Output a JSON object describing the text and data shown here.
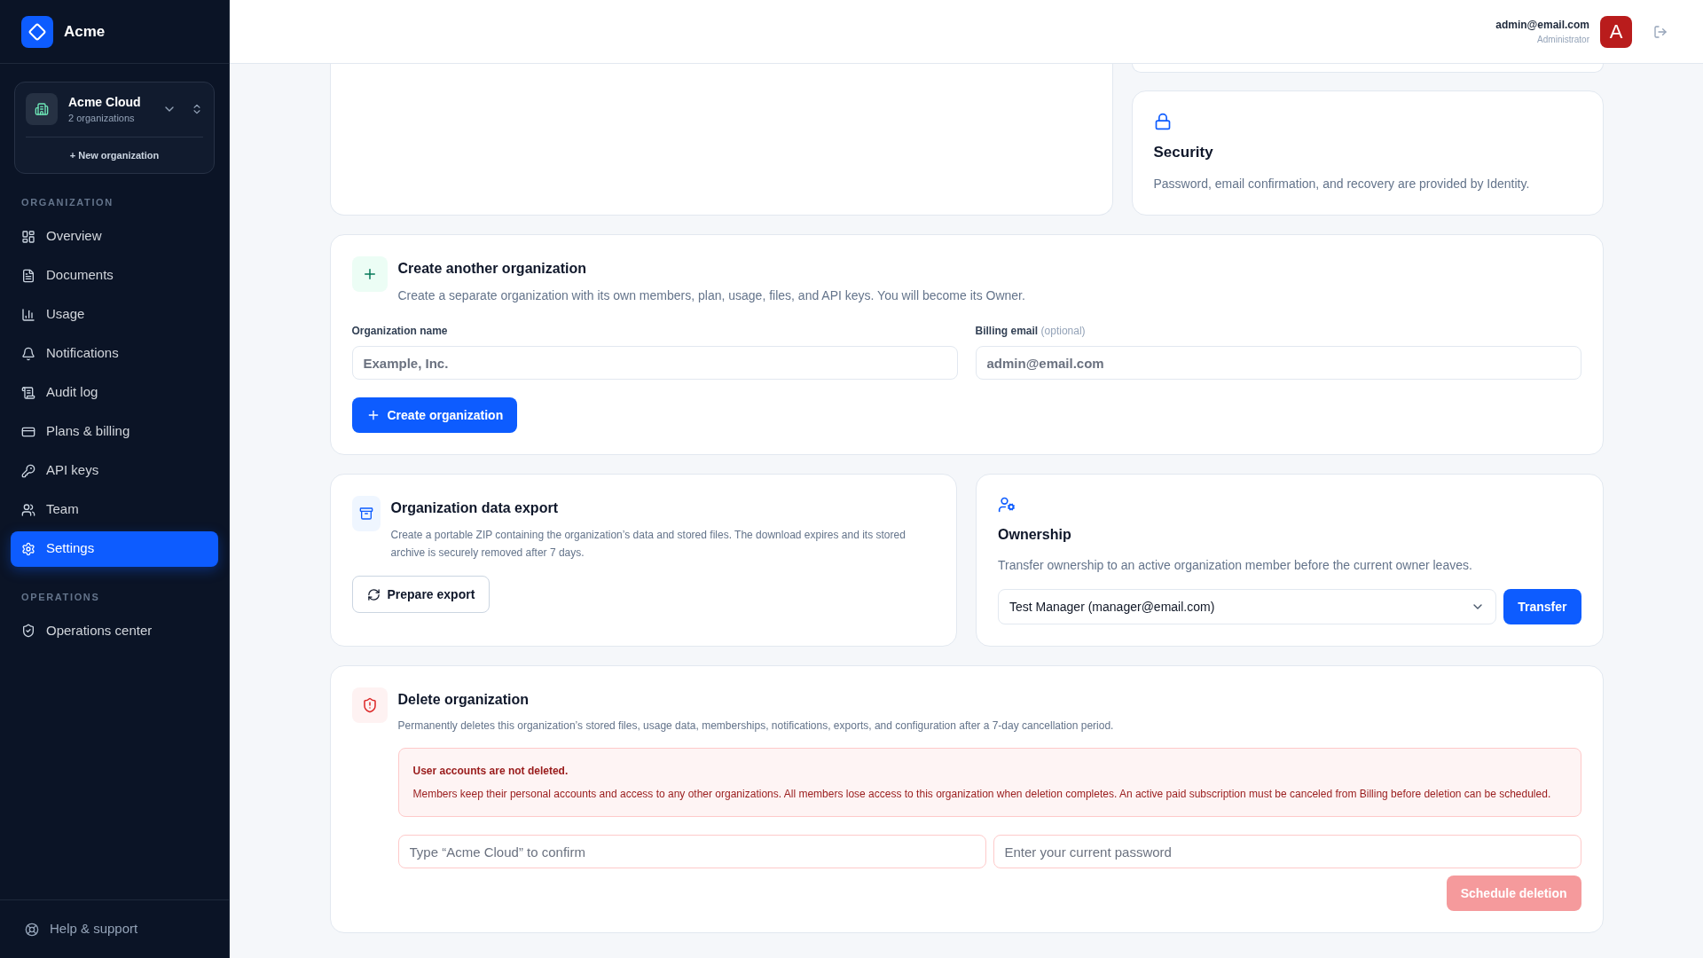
{
  "sidebar": {
    "brand": "Acme",
    "org_switcher": {
      "name": "Acme Cloud",
      "subtitle": "2 organizations",
      "new_button": "+ New organization"
    },
    "sections": [
      {
        "heading": "ORGANIZATION",
        "items": [
          {
            "label": "Overview",
            "selected": false
          },
          {
            "label": "Documents",
            "selected": false
          },
          {
            "label": "Usage",
            "selected": false
          },
          {
            "label": "Notifications",
            "selected": false
          },
          {
            "label": "Audit log",
            "selected": false
          },
          {
            "label": "Plans & billing",
            "selected": false
          },
          {
            "label": "API keys",
            "selected": false
          },
          {
            "label": "Team",
            "selected": false
          },
          {
            "label": "Settings",
            "selected": true
          }
        ]
      },
      {
        "heading": "OPERATIONS",
        "items": [
          {
            "label": "Operations center",
            "selected": false
          }
        ]
      }
    ],
    "footer_link": "Help & support"
  },
  "header": {
    "email": "admin@email.com",
    "role": "Administrator",
    "avatar_initial": "A"
  },
  "security": {
    "title": "Security",
    "description": "Password, email confirmation, and recovery are provided by Identity."
  },
  "create_org": {
    "title": "Create another organization",
    "description": "Create a separate organization with its own members, plan, usage, files, and API keys. You will become its Owner.",
    "fields": [
      {
        "label": "Organization name",
        "placeholder": "Example, Inc."
      },
      {
        "label": "Billing email",
        "note": "(optional)",
        "placeholder": "admin@email.com"
      }
    ],
    "button": "Create organization"
  },
  "export": {
    "title": "Organization data export",
    "description": "Create a portable ZIP containing the organization’s data and stored files. The download expires and its stored archive is securely removed after 7 days.",
    "button": "Prepare export"
  },
  "ownership": {
    "title": "Ownership",
    "description": "Transfer ownership to an active organization member before the current owner leaves.",
    "select_value": "Test Manager (manager@email.com)",
    "button": "Transfer"
  },
  "delete_org": {
    "title": "Delete organization",
    "description": "Permanently deletes this organization’s stored files, usage data, memberships, notifications, exports, and configuration after a 7-day cancellation period.",
    "alert": {
      "title": "User accounts are not deleted.",
      "body": "Members keep their personal accounts and access to any other organizations. All members lose access to this organization when deletion completes. An active paid subscription must be canceled from Billing before deletion can be scheduled."
    },
    "fields": [
      {
        "placeholder": "Type “Acme Cloud” to confirm"
      },
      {
        "placeholder": "Enter your current password"
      }
    ],
    "button": {
      "label": "Schedule deletion",
      "disabled": true
    }
  }
}
